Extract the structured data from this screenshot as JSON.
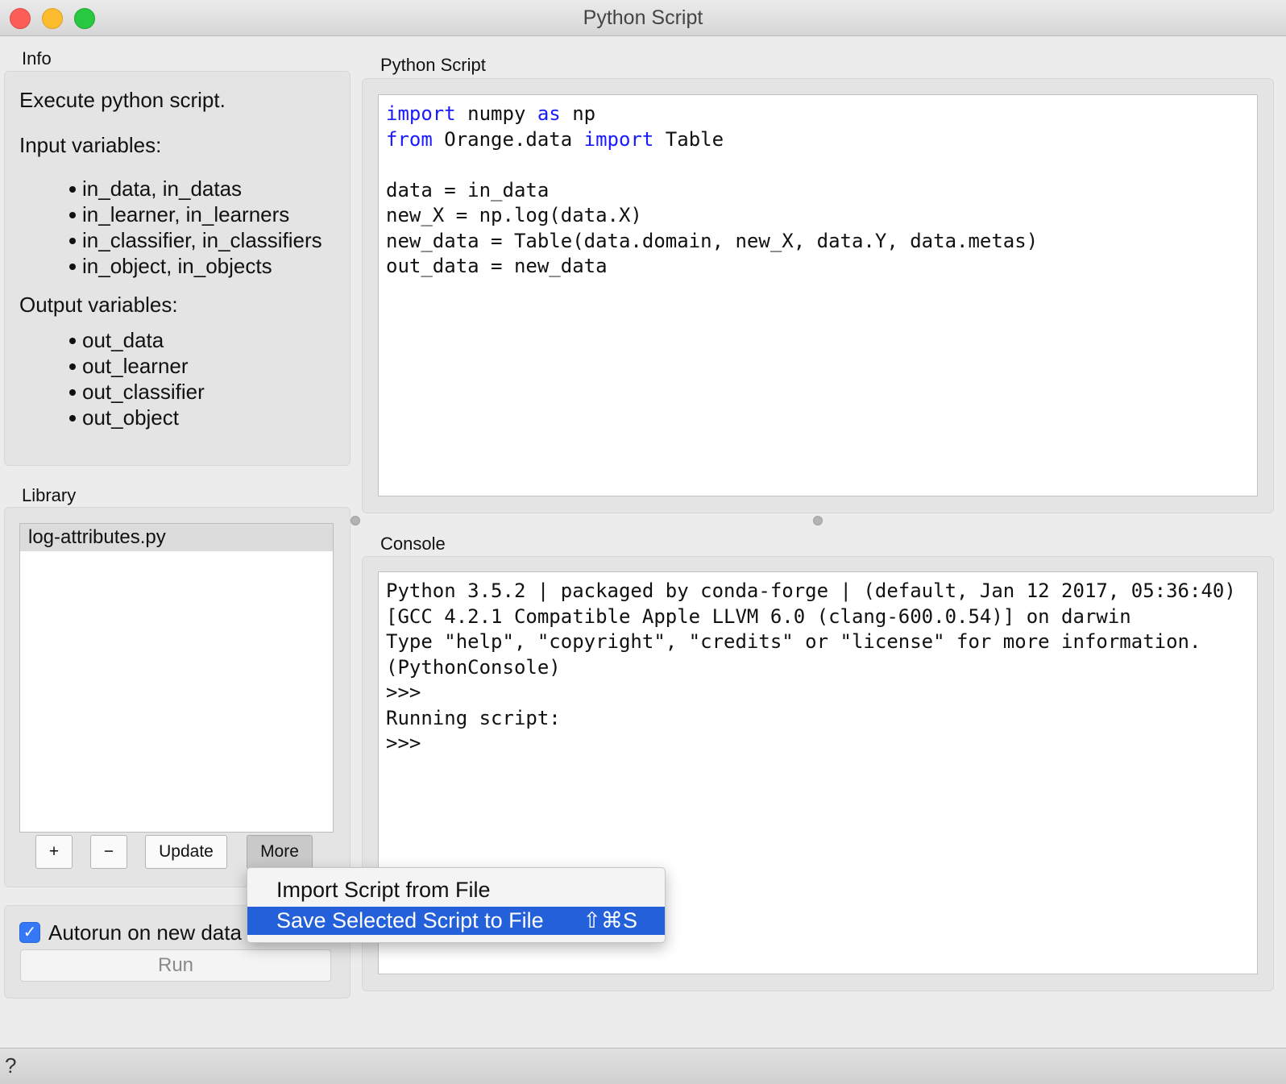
{
  "window": {
    "title": "Python Script"
  },
  "info": {
    "label": "Info",
    "description": "Execute python script.",
    "input_heading": "Input variables:",
    "inputs": [
      "in_data, in_datas",
      "in_learner, in_learners",
      "in_classifier, in_classifiers",
      "in_object, in_objects"
    ],
    "output_heading": "Output variables:",
    "outputs": [
      "out_data",
      "out_learner",
      "out_classifier",
      "out_object"
    ]
  },
  "library": {
    "label": "Library",
    "items": [
      "log-attributes.py"
    ],
    "add_label": "+",
    "remove_label": "−",
    "update_label": "Update",
    "more_label": "More"
  },
  "more_menu": {
    "items": [
      {
        "label": "Import Script from File",
        "shortcut": ""
      },
      {
        "label": "Save Selected Script to File",
        "shortcut": "⇧⌘S"
      }
    ]
  },
  "autorun": {
    "label": "Autorun on new data",
    "checked": true
  },
  "run_label": "Run",
  "script": {
    "label": "Python Script",
    "lines": [
      [
        {
          "t": "import",
          "kw": true
        },
        {
          "t": " numpy ",
          "kw": false
        },
        {
          "t": "as",
          "kw": true
        },
        {
          "t": " np",
          "kw": false
        }
      ],
      [
        {
          "t": "from",
          "kw": true
        },
        {
          "t": " Orange.data ",
          "kw": false
        },
        {
          "t": "import",
          "kw": true
        },
        {
          "t": " Table",
          "kw": false
        }
      ],
      [],
      [
        {
          "t": "data = in_data",
          "kw": false
        }
      ],
      [
        {
          "t": "new_X = np.log(data.X)",
          "kw": false
        }
      ],
      [
        {
          "t": "new_data = Table(data.domain, new_X, data.Y, data.metas)",
          "kw": false
        }
      ],
      [
        {
          "t": "out_data = new_data",
          "kw": false
        }
      ]
    ]
  },
  "console": {
    "label": "Console",
    "lines": [
      "Python 3.5.2 | packaged by conda-forge | (default, Jan 12 2017, 05:36:40)",
      "[GCC 4.2.1 Compatible Apple LLVM 6.0 (clang-600.0.54)] on darwin",
      "Type \"help\", \"copyright\", \"credits\" or \"license\" for more information.",
      "(PythonConsole)",
      ">>>",
      "Running script:",
      ">>>"
    ]
  },
  "status": {
    "help_icon": "question-icon"
  }
}
